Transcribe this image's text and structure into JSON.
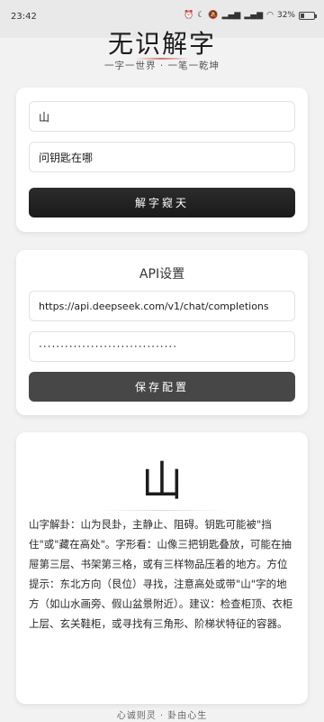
{
  "status_bar": {
    "time": "23:42",
    "indicators": [
      "alarm-icon",
      "moon-icon",
      "mute-icon",
      "signal-icon",
      "signal-icon",
      "wifi-icon"
    ],
    "battery": "32%",
    "battery_level": 0.32
  },
  "header": {
    "title": "无识解字",
    "subtitle": "一字一世界 · 一笔一乾坤"
  },
  "query_card": {
    "char_input_value": "山",
    "question_input_value": "问钥匙在哪",
    "submit_label": "解字窥天"
  },
  "api_card": {
    "title": "API设置",
    "endpoint_value": "https://api.deepseek.com/v1/chat/completions",
    "key_masked": "································",
    "save_label": "保存配置"
  },
  "result_card": {
    "character": "山",
    "reading": "山字解卦：山为艮卦，主静止、阻碍。钥匙可能被\"挡住\"或\"藏在高处\"。字形看：山像三把钥匙叠放，可能在抽屉第三层、书架第三格，或有三样物品压着的地方。方位提示：东北方向（艮位）寻找，注意高处或带\"山\"字的地方（如山水画旁、假山盆景附近）。建议：检查柜顶、衣柜上层、玄关鞋柜，或寻找有三角形、阶梯状特征的容器。"
  },
  "footer": {
    "text": "心诚则灵 · 卦由心生"
  }
}
